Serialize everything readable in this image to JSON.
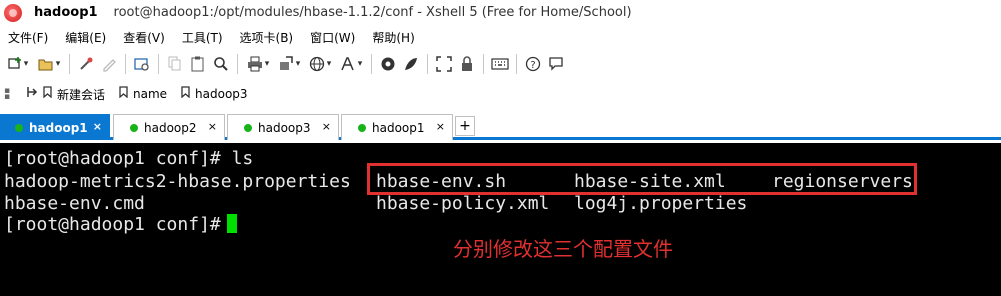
{
  "window": {
    "session_name": "hadoop1",
    "title_path": "root@hadoop1:/opt/modules/hbase-1.1.2/conf - Xshell 5 (Free for Home/School)"
  },
  "menu": [
    "文件(F)",
    "编辑(E)",
    "查看(V)",
    "工具(T)",
    "选项卡(B)",
    "窗口(W)",
    "帮助(H)"
  ],
  "links": [
    "新建会话",
    "name",
    "hadoop3"
  ],
  "tabs": [
    {
      "label": "hadoop1",
      "active": true,
      "close": "×"
    },
    {
      "label": "hadoop2",
      "active": false,
      "close": "×"
    },
    {
      "label": "hadoop3",
      "active": false,
      "close": "×"
    },
    {
      "label": "hadoop1",
      "active": false,
      "close": "×"
    }
  ],
  "tab_add": "+",
  "terminal": {
    "line1": "[root@hadoop1 conf]# ls",
    "line2a": "hadoop-metrics2-hbase.properties",
    "line2b": "hbase-env.sh",
    "line2c": "hbase-site.xml",
    "line2d": "regionservers",
    "line3a": "hbase-env.cmd",
    "line3b": "hbase-policy.xml",
    "line3c": "log4j.properties",
    "line4": "[root@hadoop1 conf]#"
  },
  "annotation": "分别修改这三个配置文件",
  "colors": {
    "accent": "#0a78d1",
    "annotation": "#e03030",
    "cursor": "#00e000",
    "status_dot": "#19b319"
  },
  "icons": [
    "new-session-icon",
    "open-folder-icon",
    "link-icon",
    "pencil-icon",
    "properties-icon",
    "copy-icon",
    "paste-icon",
    "find-icon",
    "print-icon",
    "transfer-icon",
    "globe-icon",
    "font-icon",
    "script-icon",
    "xftp-icon",
    "fullscreen-icon",
    "lock-icon",
    "keyboard-icon",
    "help-icon",
    "chat-icon"
  ]
}
